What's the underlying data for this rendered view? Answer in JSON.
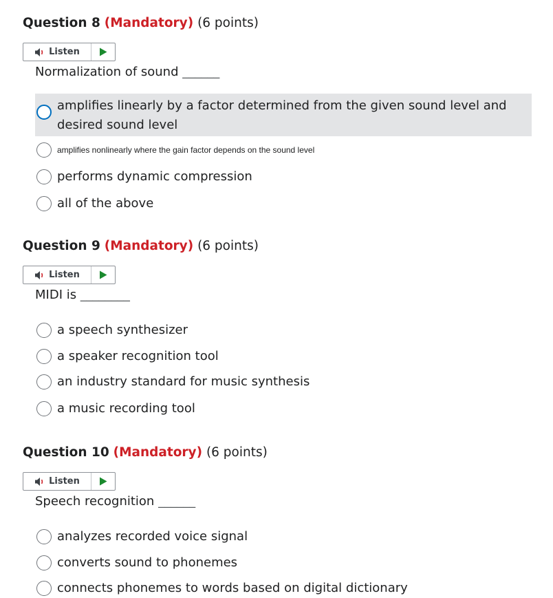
{
  "colors": {
    "mandatory": "#cd2026",
    "focus_ring": "#006fbf",
    "play": "#1a8a2e",
    "hover_bg": "#e3e4e6"
  },
  "listen_label": "Listen",
  "icons": {
    "speaker": "speaker-icon",
    "play": "play-icon"
  },
  "questions": [
    {
      "number": "Question 8",
      "mandatory": "(Mandatory)",
      "points": "(6 points)",
      "prompt": "Normalization of sound",
      "blank": "______",
      "options": [
        "amplifies linearly by a factor determined from the given sound level and desired sound level",
        "amplifies nonlinearly where the gain factor depends on the sound level",
        "performs dynamic compression",
        "all of the above"
      ]
    },
    {
      "number": "Question 9",
      "mandatory": "(Mandatory)",
      "points": "(6 points)",
      "prompt": "MIDI is",
      "blank": "________",
      "options": [
        "a speech synthesizer",
        "a speaker recognition tool",
        "an industry standard for music synthesis",
        "a music recording tool"
      ]
    },
    {
      "number": "Question 10",
      "mandatory": "(Mandatory)",
      "points": "(6 points)",
      "prompt": "Speech recognition",
      "blank": "______",
      "options": [
        "analyzes recorded voice signal",
        "converts sound to phonemes",
        "connects phonemes to words based on digital dictionary"
      ]
    }
  ]
}
